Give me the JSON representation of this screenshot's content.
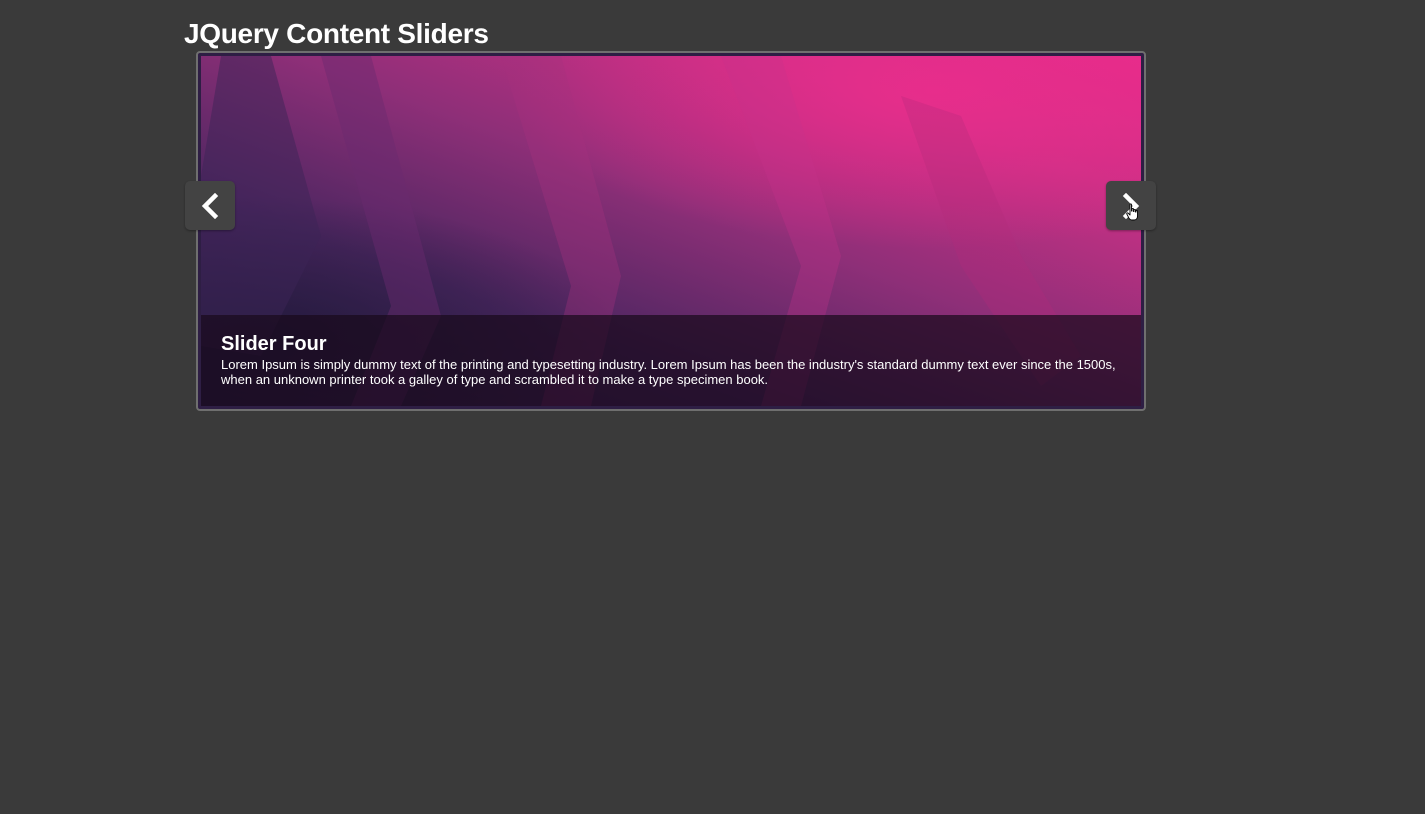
{
  "page": {
    "title": "JQuery Content Sliders"
  },
  "slider": {
    "current_slide": {
      "title": "Slider Four",
      "description": "Lorem Ipsum is simply dummy text of the printing and typesetting industry. Lorem Ipsum has been the industry's standard dummy text ever since the 1500s, when an unknown printer took a galley of type and scrambled it to make a type specimen book."
    },
    "prev_icon": "chevron-left-icon",
    "next_icon": "chevron-right-icon"
  },
  "colors": {
    "background": "#3a3a3a",
    "frame_border": "#6f6f6f",
    "nav_button": "#434343",
    "slide_pink": "#e52a88",
    "slide_purple": "#2e1f4a"
  }
}
